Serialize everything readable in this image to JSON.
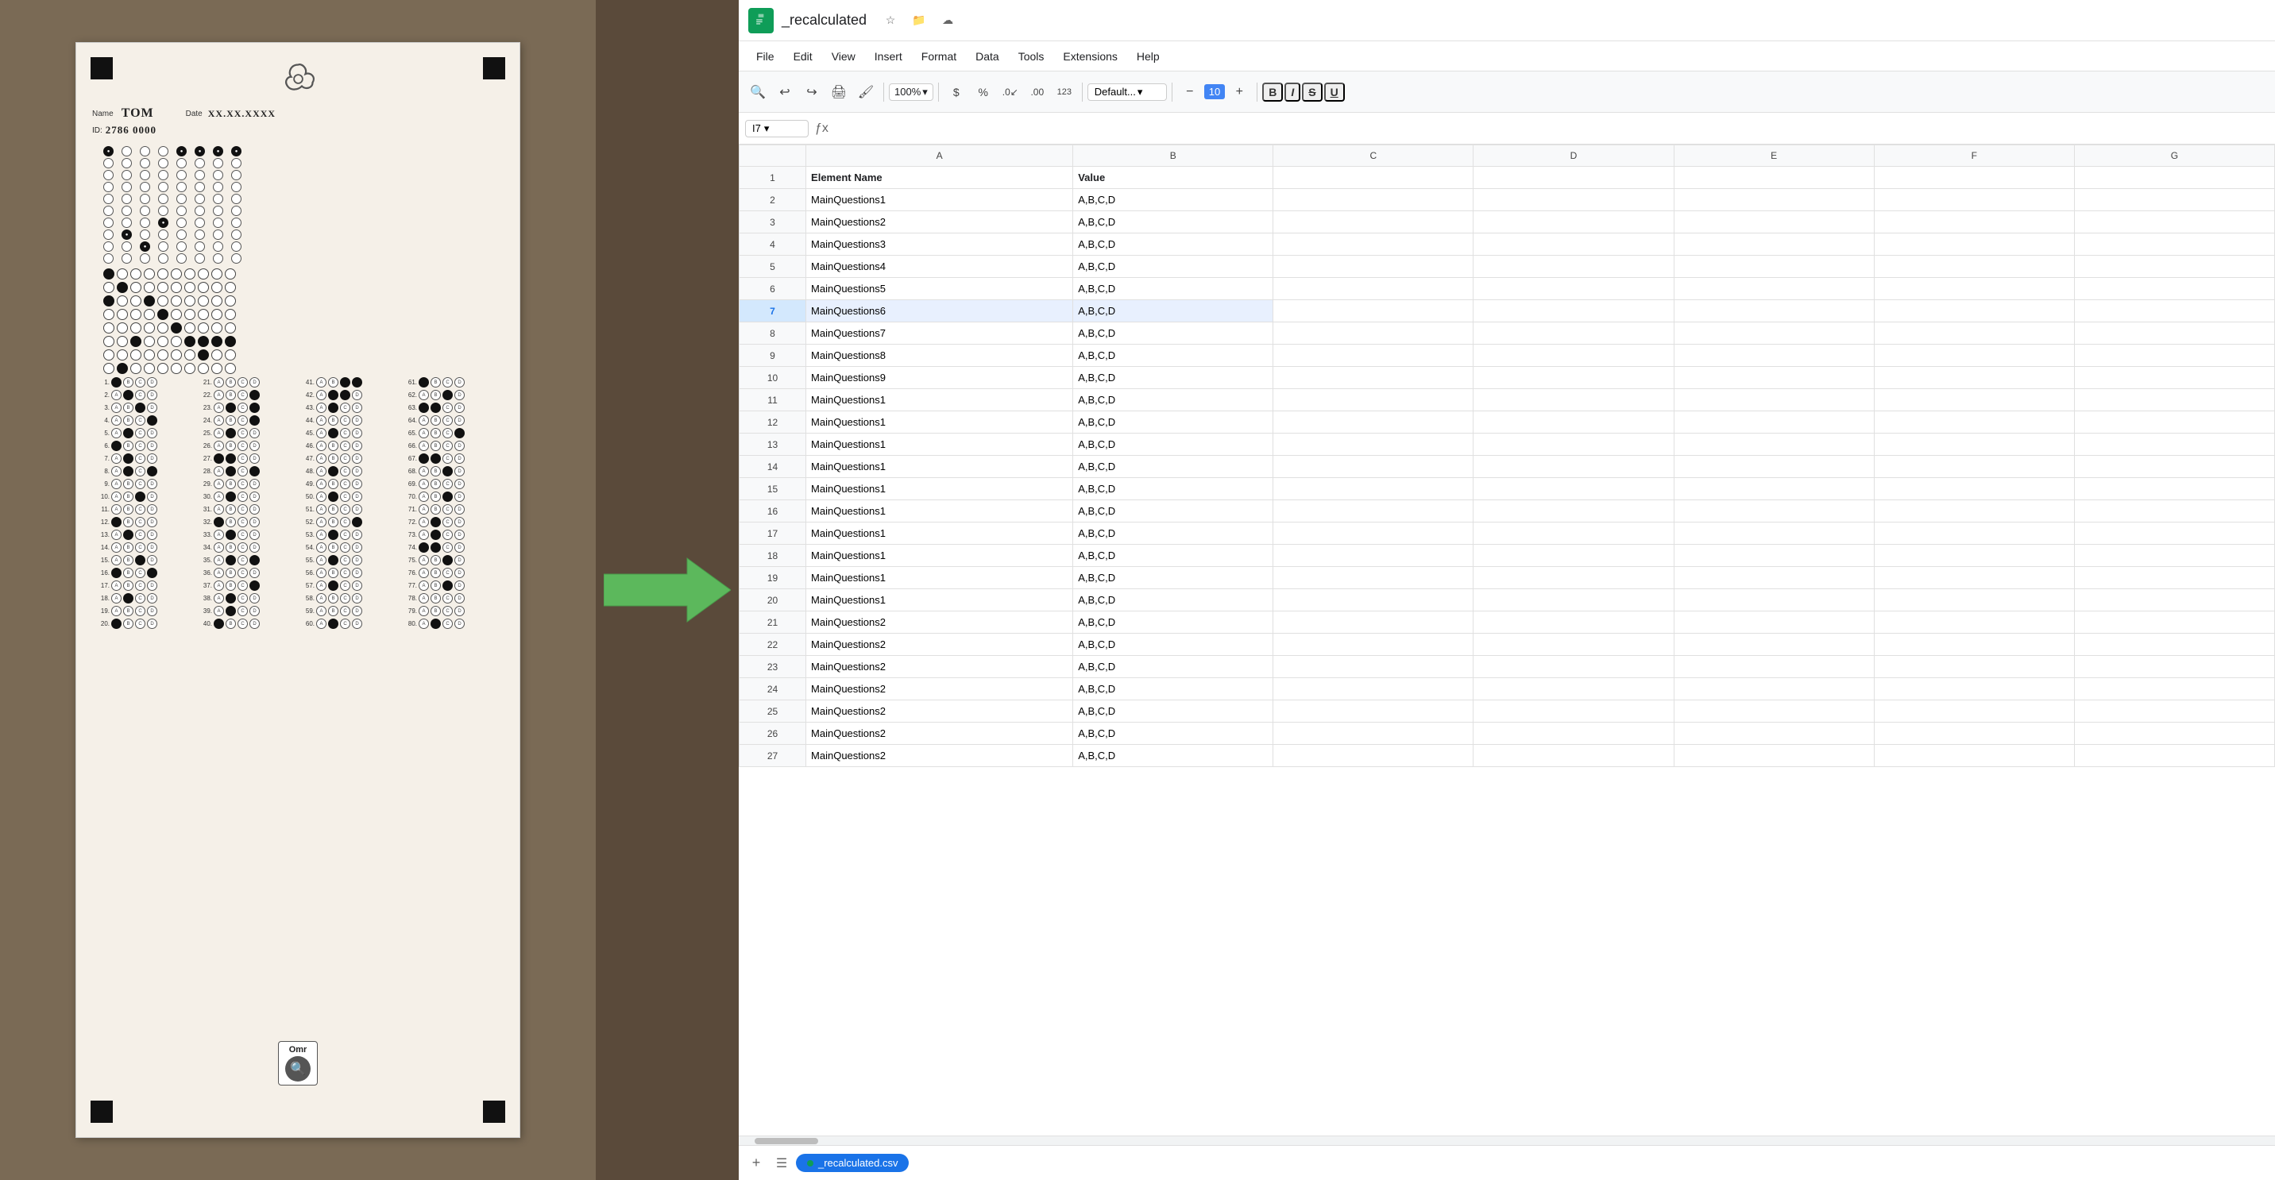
{
  "app": {
    "title": "_recalculated",
    "tab_name": "_recalculated.csv"
  },
  "menu": {
    "items": [
      "File",
      "Edit",
      "View",
      "Insert",
      "Format",
      "Data",
      "Tools",
      "Extensions",
      "Help"
    ]
  },
  "toolbar": {
    "zoom": "100%",
    "font": "Default...",
    "font_size": "10",
    "bold": "B",
    "italic": "I",
    "strikethrough": "S",
    "underline": "U"
  },
  "formula_bar": {
    "cell_ref": "I7",
    "formula": ""
  },
  "columns": {
    "headers": [
      "",
      "A",
      "B",
      "C",
      "D",
      "E",
      "F",
      "G"
    ]
  },
  "rows": [
    {
      "num": 1,
      "a": "Element Name",
      "b": "Value",
      "c": "",
      "d": "",
      "e": "",
      "f": "",
      "g": ""
    },
    {
      "num": 2,
      "a": "MainQuestions1",
      "b": "A,B,C,D",
      "c": "",
      "d": "",
      "e": "",
      "f": "",
      "g": ""
    },
    {
      "num": 3,
      "a": "MainQuestions2",
      "b": "A,B,C,D",
      "c": "",
      "d": "",
      "e": "",
      "f": "",
      "g": ""
    },
    {
      "num": 4,
      "a": "MainQuestions3",
      "b": "A,B,C,D",
      "c": "",
      "d": "",
      "e": "",
      "f": "",
      "g": ""
    },
    {
      "num": 5,
      "a": "MainQuestions4",
      "b": "A,B,C,D",
      "c": "",
      "d": "",
      "e": "",
      "f": "",
      "g": ""
    },
    {
      "num": 6,
      "a": "MainQuestions5",
      "b": "A,B,C,D",
      "c": "",
      "d": "",
      "e": "",
      "f": "",
      "g": ""
    },
    {
      "num": 7,
      "a": "MainQuestions6",
      "b": "A,B,C,D",
      "c": "",
      "d": "",
      "e": "",
      "f": "",
      "g": ""
    },
    {
      "num": 8,
      "a": "MainQuestions7",
      "b": "A,B,C,D",
      "c": "",
      "d": "",
      "e": "",
      "f": "",
      "g": ""
    },
    {
      "num": 9,
      "a": "MainQuestions8",
      "b": "A,B,C,D",
      "c": "",
      "d": "",
      "e": "",
      "f": "",
      "g": ""
    },
    {
      "num": 10,
      "a": "MainQuestions9",
      "b": "A,B,C,D",
      "c": "",
      "d": "",
      "e": "",
      "f": "",
      "g": ""
    },
    {
      "num": 11,
      "a": "MainQuestions1",
      "b": "A,B,C,D",
      "c": "",
      "d": "",
      "e": "",
      "f": "",
      "g": ""
    },
    {
      "num": 12,
      "a": "MainQuestions1",
      "b": "A,B,C,D",
      "c": "",
      "d": "",
      "e": "",
      "f": "",
      "g": ""
    },
    {
      "num": 13,
      "a": "MainQuestions1",
      "b": "A,B,C,D",
      "c": "",
      "d": "",
      "e": "",
      "f": "",
      "g": ""
    },
    {
      "num": 14,
      "a": "MainQuestions1",
      "b": "A,B,C,D",
      "c": "",
      "d": "",
      "e": "",
      "f": "",
      "g": ""
    },
    {
      "num": 15,
      "a": "MainQuestions1",
      "b": "A,B,C,D",
      "c": "",
      "d": "",
      "e": "",
      "f": "",
      "g": ""
    },
    {
      "num": 16,
      "a": "MainQuestions1",
      "b": "A,B,C,D",
      "c": "",
      "d": "",
      "e": "",
      "f": "",
      "g": ""
    },
    {
      "num": 17,
      "a": "MainQuestions1",
      "b": "A,B,C,D",
      "c": "",
      "d": "",
      "e": "",
      "f": "",
      "g": ""
    },
    {
      "num": 18,
      "a": "MainQuestions1",
      "b": "A,B,C,D",
      "c": "",
      "d": "",
      "e": "",
      "f": "",
      "g": ""
    },
    {
      "num": 19,
      "a": "MainQuestions1",
      "b": "A,B,C,D",
      "c": "",
      "d": "",
      "e": "",
      "f": "",
      "g": ""
    },
    {
      "num": 20,
      "a": "MainQuestions1",
      "b": "A,B,C,D",
      "c": "",
      "d": "",
      "e": "",
      "f": "",
      "g": ""
    },
    {
      "num": 21,
      "a": "MainQuestions2",
      "b": "A,B,C,D",
      "c": "",
      "d": "",
      "e": "",
      "f": "",
      "g": ""
    },
    {
      "num": 22,
      "a": "MainQuestions2",
      "b": "A,B,C,D",
      "c": "",
      "d": "",
      "e": "",
      "f": "",
      "g": ""
    },
    {
      "num": 23,
      "a": "MainQuestions2",
      "b": "A,B,C,D",
      "c": "",
      "d": "",
      "e": "",
      "f": "",
      "g": ""
    },
    {
      "num": 24,
      "a": "MainQuestions2",
      "b": "A,B,C,D",
      "c": "",
      "d": "",
      "e": "",
      "f": "",
      "g": ""
    },
    {
      "num": 25,
      "a": "MainQuestions2",
      "b": "A,B,C,D",
      "c": "",
      "d": "",
      "e": "",
      "f": "",
      "g": ""
    },
    {
      "num": 26,
      "a": "MainQuestions2",
      "b": "A,B,C,D",
      "c": "",
      "d": "",
      "e": "",
      "f": "",
      "g": ""
    },
    {
      "num": 27,
      "a": "MainQuestions2",
      "b": "A,B,C,D",
      "c": "",
      "d": "",
      "e": "",
      "f": "",
      "g": ""
    }
  ],
  "omr_sheet": {
    "name_label": "Name",
    "name_value": "TOM",
    "date_label": "Date",
    "date_value": "XX.XX.XXXX",
    "id_label": "ID:",
    "id_value": "2786 0000",
    "omr_label": "Omr"
  }
}
